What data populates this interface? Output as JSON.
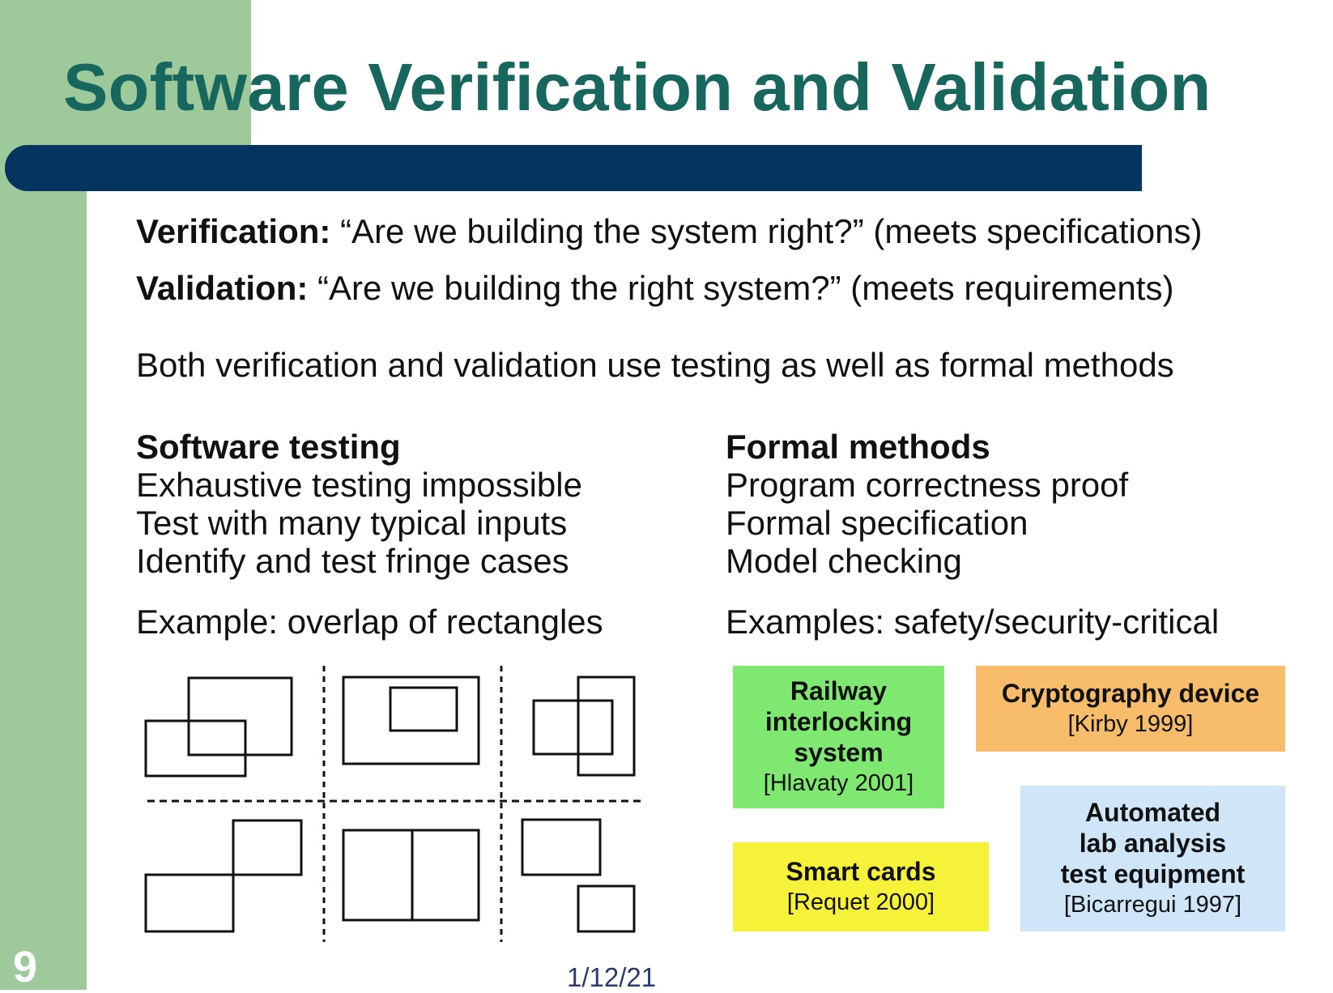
{
  "slide": {
    "title": "Software Verification and Validation",
    "verification_label": "Verification:",
    "verification_text": " “Are we building the system right?” (meets specifications)",
    "validation_label": "Validation:",
    "validation_text": " “Are we building the right system?” (meets requirements)",
    "both_text": "Both verification and validation use testing as well as formal methods",
    "testing": {
      "heading": "Software testing",
      "items": [
        "Exhaustive testing impossible",
        "Test with many typical inputs",
        "Identify and test fringe cases"
      ],
      "example": "Example: overlap of rectangles"
    },
    "formal": {
      "heading": "Formal methods",
      "items": [
        "Program correctness proof",
        "Formal specification",
        "Model checking"
      ],
      "example": "Examples: safety/security-critical"
    },
    "boxes": {
      "railway": {
        "title_lines": [
          "Railway",
          "interlocking",
          "system"
        ],
        "ref": "[Hlavaty 2001]"
      },
      "crypto": {
        "title": "Cryptography device",
        "ref": "[Kirby 1999]"
      },
      "smartcards": {
        "title": "Smart cards",
        "ref": "[Requet 2000]"
      },
      "lab": {
        "title_lines": [
          "Automated",
          "lab analysis",
          "test equipment"
        ],
        "ref": "[Bicarregui 1997]"
      }
    },
    "slide_number": "9",
    "date": "1/12/21"
  },
  "colors": {
    "sidebar": "#9dc99b",
    "title": "#17675f",
    "bar": "#063461",
    "railway_box": "#7fe870",
    "crypto_box": "#f8bd6b",
    "smartcards_box": "#f6f23a",
    "lab_box": "#cfe6f8"
  }
}
